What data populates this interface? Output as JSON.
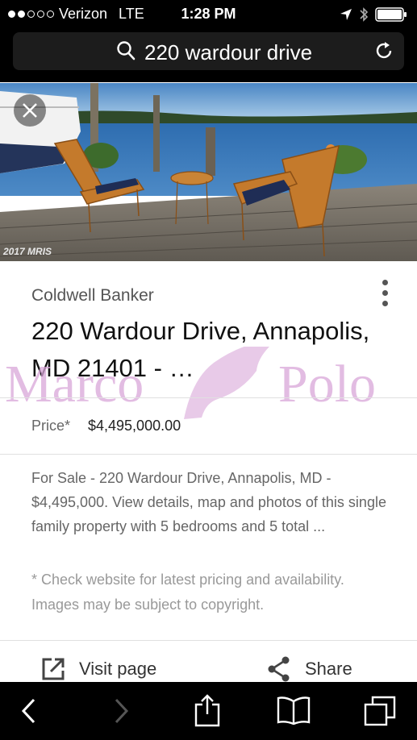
{
  "status_bar": {
    "carrier": "Verizon",
    "network": "LTE",
    "time": "1:28 PM",
    "signal_bars_filled": 2,
    "signal_bars_total": 5
  },
  "address_bar": {
    "query": "220 wardour drive"
  },
  "image": {
    "copyright": "2017 MRIS"
  },
  "result": {
    "source": "Coldwell Banker",
    "title": "220 Wardour Drive, Annapolis, MD 21401 - …",
    "price_label": "Price*",
    "price_value": "$4,495,000.00",
    "description": "For Sale - 220 Wardour Drive, Annapolis, MD - $4,495,000. View details, map and photos of this single family property with 5 bedrooms and 5 total ...",
    "disclaimer": "* Check website for latest pricing and availability. Images may be subject to copyright."
  },
  "actions": {
    "visit": "Visit page",
    "share": "Share"
  },
  "watermark": {
    "text_left": "Marco",
    "text_right": "Polo",
    "color": "#d9a6d9"
  },
  "colors": {
    "bar_background": "#000000",
    "url_field": "#1c1c1c"
  }
}
